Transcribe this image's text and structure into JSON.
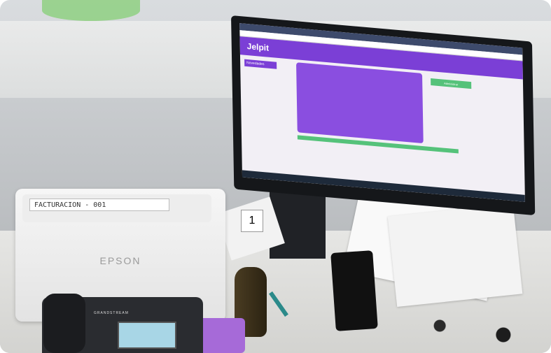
{
  "scene": {
    "type": "office desk photo",
    "accent_colors": {
      "app_purple": "#7b3fd6",
      "app_green": "#55c27a"
    }
  },
  "monitor": {
    "app": {
      "logo": "Jelpit",
      "sidebar_button": "Novedades",
      "green_button": "Administrar"
    }
  },
  "scanner": {
    "label": "FACTURACION - 001",
    "brand": "EPSON"
  },
  "phone_device": {
    "brand": "GRANDSTREAM"
  },
  "holder_badge": "1"
}
